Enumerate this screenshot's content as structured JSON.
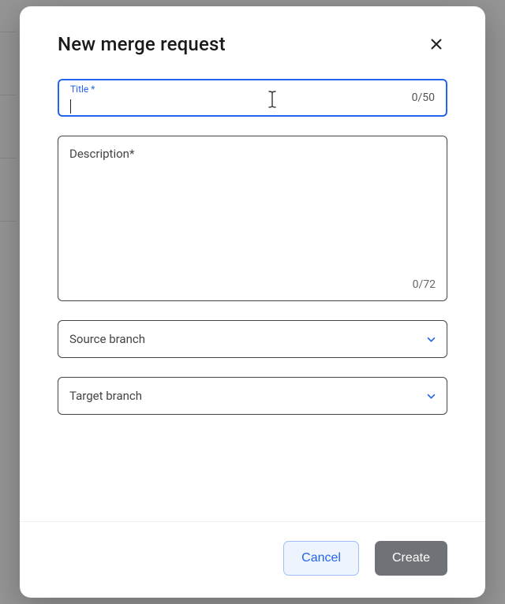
{
  "modal": {
    "title": "New merge request"
  },
  "fields": {
    "title": {
      "label": "Title *",
      "value": "",
      "counter": "0/50"
    },
    "description": {
      "placeholder": "Description*",
      "value": "",
      "counter": "0/72"
    },
    "source_branch": {
      "label": "Source branch"
    },
    "target_branch": {
      "label": "Target branch"
    }
  },
  "footer": {
    "cancel": "Cancel",
    "create": "Create"
  }
}
